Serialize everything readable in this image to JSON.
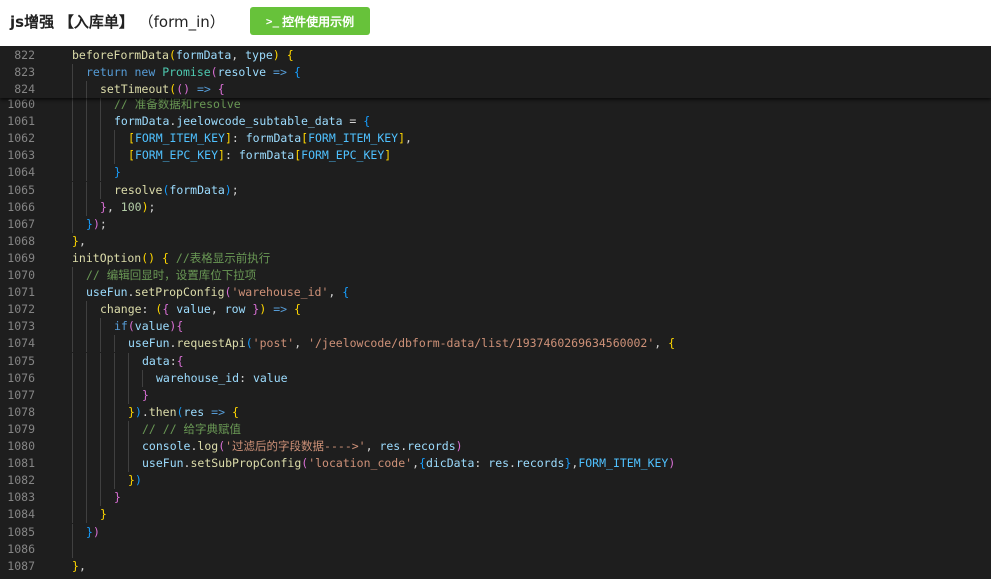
{
  "header": {
    "title_prefix": "js增强",
    "title_bracket": "【入库单】",
    "title_suffix": "（form_in）",
    "demo_button_icon": ">_",
    "demo_button_label": "控件使用示例",
    "button_color": "#67c23a"
  },
  "editor": {
    "theme_background": "#1e1e1e",
    "sticky_lines": [
      {
        "ln": "822",
        "indent": 0,
        "tokens": [
          [
            "fn",
            "beforeFormData"
          ],
          [
            "b1c",
            "("
          ],
          [
            "vr",
            "formData"
          ],
          [
            "pn",
            ", "
          ],
          [
            "vr",
            "type"
          ],
          [
            "b1c",
            ")"
          ],
          [
            "pn",
            " "
          ],
          [
            "b1c",
            "{"
          ]
        ]
      },
      {
        "ln": "823",
        "indent": 1,
        "tokens": [
          [
            "kw",
            "return"
          ],
          [
            "pn",
            " "
          ],
          [
            "kw",
            "new"
          ],
          [
            "pn",
            " "
          ],
          [
            "cl",
            "Promise"
          ],
          [
            "b2c",
            "("
          ],
          [
            "vr",
            "resolve"
          ],
          [
            "pn",
            " "
          ],
          [
            "kw",
            "=>"
          ],
          [
            "pn",
            " "
          ],
          [
            "b3c",
            "{"
          ]
        ]
      },
      {
        "ln": "824",
        "indent": 2,
        "tokens": [
          [
            "fn",
            "setTimeout"
          ],
          [
            "b1c",
            "("
          ],
          [
            "b2c",
            "()"
          ],
          [
            "pn",
            " "
          ],
          [
            "kw",
            "=>"
          ],
          [
            "pn",
            " "
          ],
          [
            "b2c",
            "{"
          ]
        ]
      }
    ],
    "lines": [
      {
        "ln": "1060",
        "indent": 3,
        "tokens": [
          [
            "cm",
            "// 准备数据和resolve"
          ]
        ]
      },
      {
        "ln": "1061",
        "indent": 3,
        "tokens": [
          [
            "vr",
            "formData"
          ],
          [
            "pn",
            "."
          ],
          [
            "vr",
            "jeelowcode_subtable_data"
          ],
          [
            "pn",
            " = "
          ],
          [
            "b3c",
            "{"
          ]
        ]
      },
      {
        "ln": "1062",
        "indent": 4,
        "tokens": [
          [
            "b1c",
            "["
          ],
          [
            "cst",
            "FORM_ITEM_KEY"
          ],
          [
            "b1c",
            "]"
          ],
          [
            "pn",
            ": "
          ],
          [
            "vr",
            "formData"
          ],
          [
            "b1c",
            "["
          ],
          [
            "cst",
            "FORM_ITEM_KEY"
          ],
          [
            "b1c",
            "]"
          ],
          [
            "pn",
            ","
          ]
        ]
      },
      {
        "ln": "1063",
        "indent": 4,
        "tokens": [
          [
            "b1c",
            "["
          ],
          [
            "cst",
            "FORM_EPC_KEY"
          ],
          [
            "b1c",
            "]"
          ],
          [
            "pn",
            ": "
          ],
          [
            "vr",
            "formData"
          ],
          [
            "b1c",
            "["
          ],
          [
            "cst",
            "FORM_EPC_KEY"
          ],
          [
            "b1c",
            "]"
          ]
        ]
      },
      {
        "ln": "1064",
        "indent": 3,
        "tokens": [
          [
            "b3c",
            "}"
          ]
        ]
      },
      {
        "ln": "1065",
        "indent": 3,
        "tokens": [
          [
            "fn",
            "resolve"
          ],
          [
            "b3c",
            "("
          ],
          [
            "vr",
            "formData"
          ],
          [
            "b3c",
            ")"
          ],
          [
            "pn",
            ";"
          ]
        ]
      },
      {
        "ln": "1066",
        "indent": 2,
        "tokens": [
          [
            "b2c",
            "}"
          ],
          [
            "pn",
            ", "
          ],
          [
            "nm",
            "100"
          ],
          [
            "b1c",
            ")"
          ],
          [
            "pn",
            ";"
          ]
        ]
      },
      {
        "ln": "1067",
        "indent": 1,
        "tokens": [
          [
            "b3c",
            "}"
          ],
          [
            "b2c",
            ")"
          ],
          [
            "pn",
            ";"
          ]
        ]
      },
      {
        "ln": "1068",
        "indent": 0,
        "tokens": [
          [
            "b1c",
            "}"
          ],
          [
            "pn",
            ","
          ]
        ]
      },
      {
        "ln": "1069",
        "indent": 0,
        "tokens": [
          [
            "fn",
            "initOption"
          ],
          [
            "b1c",
            "()"
          ],
          [
            "pn",
            " "
          ],
          [
            "b1c",
            "{"
          ],
          [
            "pn",
            " "
          ],
          [
            "cm",
            "//表格显示前执行"
          ]
        ]
      },
      {
        "ln": "1070",
        "indent": 1,
        "tokens": [
          [
            "cm",
            "// 编辑回显时，设置库位下拉项"
          ]
        ]
      },
      {
        "ln": "1071",
        "indent": 1,
        "tokens": [
          [
            "vr",
            "useFun"
          ],
          [
            "pn",
            "."
          ],
          [
            "fn",
            "setPropConfig"
          ],
          [
            "b2c",
            "("
          ],
          [
            "st",
            "'warehouse_id'"
          ],
          [
            "pn",
            ", "
          ],
          [
            "b3c",
            "{"
          ]
        ]
      },
      {
        "ln": "1072",
        "indent": 2,
        "tokens": [
          [
            "fn",
            "change"
          ],
          [
            "pn",
            ": "
          ],
          [
            "b1c",
            "("
          ],
          [
            "b2c",
            "{"
          ],
          [
            "pn",
            " "
          ],
          [
            "vr",
            "value"
          ],
          [
            "pn",
            ", "
          ],
          [
            "vr",
            "row"
          ],
          [
            "pn",
            " "
          ],
          [
            "b2c",
            "}"
          ],
          [
            "b1c",
            ")"
          ],
          [
            "pn",
            " "
          ],
          [
            "kw",
            "=>"
          ],
          [
            "pn",
            " "
          ],
          [
            "b1c",
            "{"
          ]
        ]
      },
      {
        "ln": "1073",
        "indent": 3,
        "tokens": [
          [
            "kw",
            "if"
          ],
          [
            "b2c",
            "("
          ],
          [
            "vr",
            "value"
          ],
          [
            "b2c",
            ")"
          ],
          [
            "b2c",
            "{"
          ]
        ]
      },
      {
        "ln": "1074",
        "indent": 4,
        "tokens": [
          [
            "vr",
            "useFun"
          ],
          [
            "pn",
            "."
          ],
          [
            "fn",
            "requestApi"
          ],
          [
            "b3c",
            "("
          ],
          [
            "st",
            "'post'"
          ],
          [
            "pn",
            ", "
          ],
          [
            "st",
            "'/jeelowcode/dbform-data/list/1937460269634560002'"
          ],
          [
            "pn",
            ", "
          ],
          [
            "b1c",
            "{"
          ]
        ]
      },
      {
        "ln": "1075",
        "indent": 5,
        "tokens": [
          [
            "vr",
            "data"
          ],
          [
            "pn",
            ":"
          ],
          [
            "b2c",
            "{"
          ]
        ]
      },
      {
        "ln": "1076",
        "indent": 6,
        "tokens": [
          [
            "vr",
            "warehouse_id"
          ],
          [
            "pn",
            ": "
          ],
          [
            "vr",
            "value"
          ]
        ]
      },
      {
        "ln": "1077",
        "indent": 5,
        "tokens": [
          [
            "b2c",
            "}"
          ]
        ]
      },
      {
        "ln": "1078",
        "indent": 4,
        "tokens": [
          [
            "b1c",
            "}"
          ],
          [
            "b3c",
            ")"
          ],
          [
            "pn",
            "."
          ],
          [
            "fn",
            "then"
          ],
          [
            "b3c",
            "("
          ],
          [
            "vr",
            "res"
          ],
          [
            "pn",
            " "
          ],
          [
            "kw",
            "=>"
          ],
          [
            "pn",
            " "
          ],
          [
            "b1c",
            "{"
          ]
        ]
      },
      {
        "ln": "1079",
        "indent": 5,
        "tokens": [
          [
            "cm",
            "// // 给字典赋值"
          ]
        ]
      },
      {
        "ln": "1080",
        "indent": 5,
        "tokens": [
          [
            "vr",
            "console"
          ],
          [
            "pn",
            "."
          ],
          [
            "fn",
            "log"
          ],
          [
            "b2c",
            "("
          ],
          [
            "st",
            "'过滤后的字段数据---->'"
          ],
          [
            "pn",
            ", "
          ],
          [
            "vr",
            "res"
          ],
          [
            "pn",
            "."
          ],
          [
            "vr",
            "records"
          ],
          [
            "b2c",
            ")"
          ]
        ]
      },
      {
        "ln": "1081",
        "indent": 5,
        "tokens": [
          [
            "vr",
            "useFun"
          ],
          [
            "pn",
            "."
          ],
          [
            "fn",
            "setSubPropConfig"
          ],
          [
            "b2c",
            "("
          ],
          [
            "st",
            "'location_code'"
          ],
          [
            "pn",
            ","
          ],
          [
            "b3c",
            "{"
          ],
          [
            "vr",
            "dicData"
          ],
          [
            "pn",
            ": "
          ],
          [
            "vr",
            "res"
          ],
          [
            "pn",
            "."
          ],
          [
            "vr",
            "records"
          ],
          [
            "b3c",
            "}"
          ],
          [
            "pn",
            ","
          ],
          [
            "cst",
            "FORM_ITEM_KEY"
          ],
          [
            "b2c",
            ")"
          ]
        ]
      },
      {
        "ln": "1082",
        "indent": 4,
        "tokens": [
          [
            "b1c",
            "}"
          ],
          [
            "b3c",
            ")"
          ]
        ]
      },
      {
        "ln": "1083",
        "indent": 3,
        "tokens": [
          [
            "b2c",
            "}"
          ]
        ]
      },
      {
        "ln": "1084",
        "indent": 2,
        "tokens": [
          [
            "b1c",
            "}"
          ]
        ]
      },
      {
        "ln": "1085",
        "indent": 1,
        "tokens": [
          [
            "b3c",
            "}"
          ],
          [
            "b2c",
            ")"
          ]
        ]
      },
      {
        "ln": "1086",
        "indent": 1,
        "tokens": []
      },
      {
        "ln": "1087",
        "indent": 0,
        "tokens": [
          [
            "b1c",
            "}"
          ],
          [
            "pn",
            ","
          ]
        ]
      }
    ]
  }
}
